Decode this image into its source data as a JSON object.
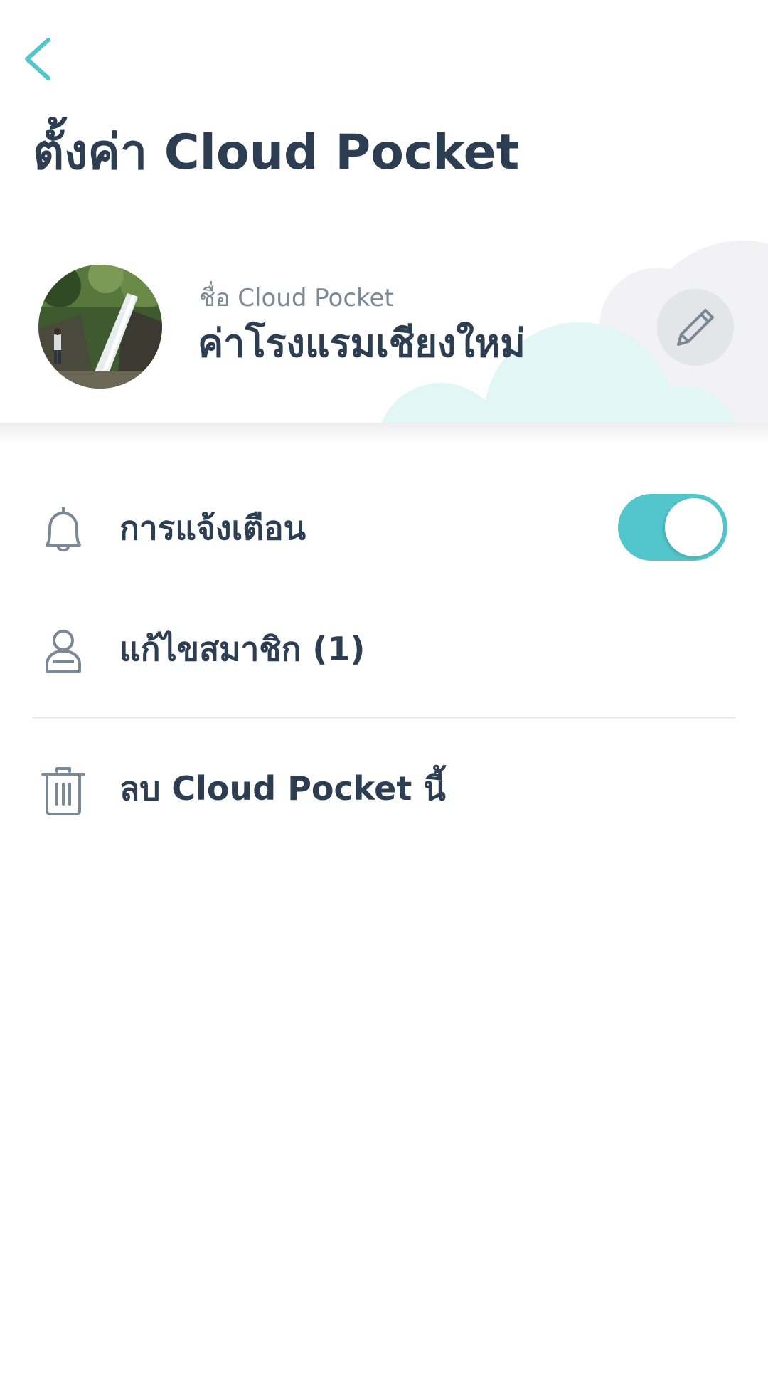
{
  "header": {
    "back_icon": "chevron-left-icon",
    "title": "ตั้งค่า Cloud Pocket"
  },
  "pocket": {
    "name_caption": "ชื่อ Cloud Pocket",
    "name": "ค่าโรงแรมเชียงใหม่",
    "photo": "waterfall-photo",
    "edit_icon": "pencil-icon"
  },
  "settings": {
    "notifications": {
      "label": "การแจ้งเตือน",
      "icon": "bell-icon",
      "enabled": true
    },
    "members": {
      "label": "แก้ไขสมาชิก (1)",
      "icon": "person-icon"
    },
    "delete": {
      "label": "ลบ Cloud Pocket นี้",
      "icon": "trash-icon"
    }
  },
  "colors": {
    "accent": "#52c6cb",
    "title_text": "#2e3e52",
    "secondary_text": "#7b8895",
    "icon_gray": "#7b8895",
    "cloud_teal": "#e3f6f6",
    "cloud_gray": "#f2f2f4"
  }
}
